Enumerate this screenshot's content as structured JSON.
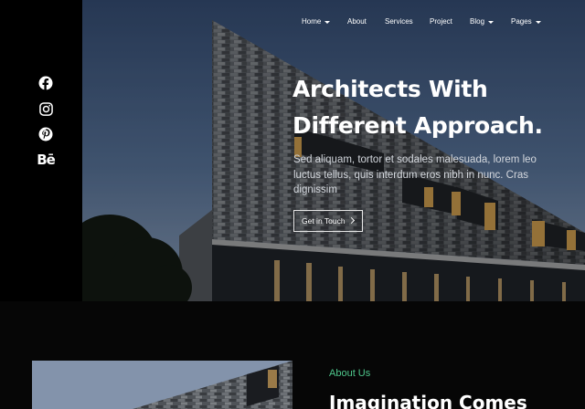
{
  "nav": {
    "items": [
      {
        "label": "Home",
        "has_dropdown": true
      },
      {
        "label": "About",
        "has_dropdown": false
      },
      {
        "label": "Services",
        "has_dropdown": false
      },
      {
        "label": "Project",
        "has_dropdown": false
      },
      {
        "label": "Blog",
        "has_dropdown": true
      },
      {
        "label": "Pages",
        "has_dropdown": true
      }
    ]
  },
  "social": {
    "icons": [
      "facebook-icon",
      "instagram-icon",
      "pinterest-icon",
      "behance-icon"
    ],
    "behance_text": "Bē"
  },
  "hero": {
    "title_line1": "Architects With",
    "title_line2": "Different Approach.",
    "text": "Sed aliquam, tortor et sodales malesuada, lorem leo luctus tellus, quis interdum eros nibh in nunc. Cras dignissim",
    "cta_label": "Get in Touch"
  },
  "about": {
    "label": "About Us",
    "heading": "Imagination Comes"
  },
  "colors": {
    "accent": "#4fc78c",
    "background": "#060606",
    "sidebar": "#000000"
  }
}
